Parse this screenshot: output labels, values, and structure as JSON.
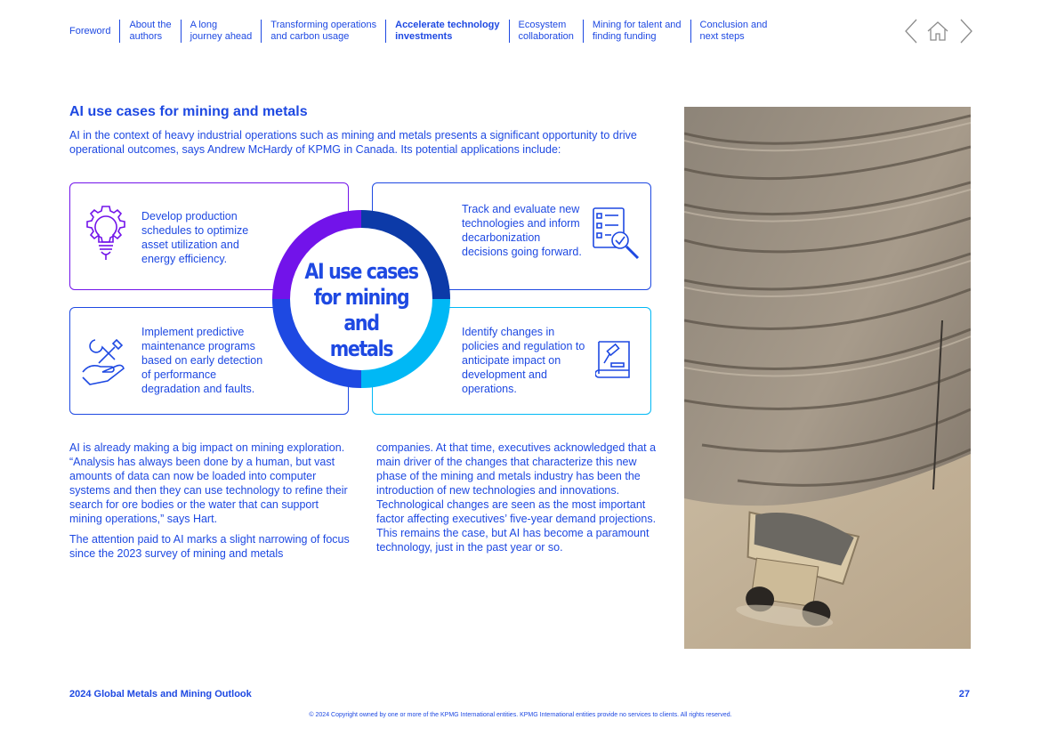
{
  "nav": {
    "items": [
      {
        "label": "Foreword"
      },
      {
        "label": "About the\nauthors"
      },
      {
        "label": "A long\njourney ahead"
      },
      {
        "label": "Transforming operations\nand carbon usage"
      },
      {
        "label": "Accelerate technology\ninvestments"
      },
      {
        "label": "Ecosystem\ncollaboration"
      },
      {
        "label": "Mining for talent and\nfinding funding"
      },
      {
        "label": "Conclusion and\nnext steps"
      }
    ],
    "active_index": 4,
    "icons": [
      "chevron-left-icon",
      "home-icon",
      "chevron-right-icon"
    ]
  },
  "heading": "AI use cases for mining and metals",
  "intro": "AI in the context of heavy industrial operations such as mining and metals presents a significant opportunity to drive operational outcomes, says Andrew McHardy of KPMG in Canada. Its potential applications include:",
  "diagram": {
    "center_lines": [
      "AI use cases",
      "for mining and",
      "metals"
    ],
    "boxes": [
      {
        "text": "Develop production schedules to optimize asset utilization and energy efficiency.",
        "icon": "lightbulb-gear-icon",
        "color": "#7213ea"
      },
      {
        "text": "Track and evaluate new technologies and inform decarbonization decisions going forward.",
        "icon": "checklist-magnifier-icon",
        "color": "#1e49e2"
      },
      {
        "text": "Implement predictive maintenance programs based on early detection of performance degradation and faults.",
        "icon": "hand-tools-icon",
        "color": "#1e49e2"
      },
      {
        "text": "Identify changes in policies and regulation to anticipate impact on development and operations.",
        "icon": "law-book-icon",
        "color": "#00b8f5"
      }
    ]
  },
  "body": {
    "left_paragraphs": [
      "AI is already making a big impact on mining exploration. “Analysis has always been done by a human, but vast amounts of data can now be loaded into computer systems and then they can use technology to refine their search for ore bodies or the water that can support mining operations,” says Hart.",
      "The attention paid to AI marks a slight narrowing of focus since the 2023 survey of mining and metals"
    ],
    "right_paragraphs": [
      "companies. At that time, executives acknowledged that a main driver of the changes that characterize this new phase of the mining and metals industry has been the introduction of new technologies and innovations. Technological changes are seen as the most important factor affecting executives’ five-year demand projections. This remains the case, but AI has become a paramount technology, just in the past year or so."
    ]
  },
  "photo": {
    "subject": "haul truck in open-pit mine"
  },
  "footer": {
    "title": "2024 Global Metals and Mining Outlook",
    "page": "27",
    "copyright": "© 2024 Copyright owned by one or more of the KPMG International entities. KPMG International entities provide no services to clients. All rights reserved."
  },
  "colors": {
    "brand_blue": "#1e49e2",
    "purple": "#7213ea",
    "cyan": "#00b8f5",
    "navy": "#0c2d8a"
  }
}
